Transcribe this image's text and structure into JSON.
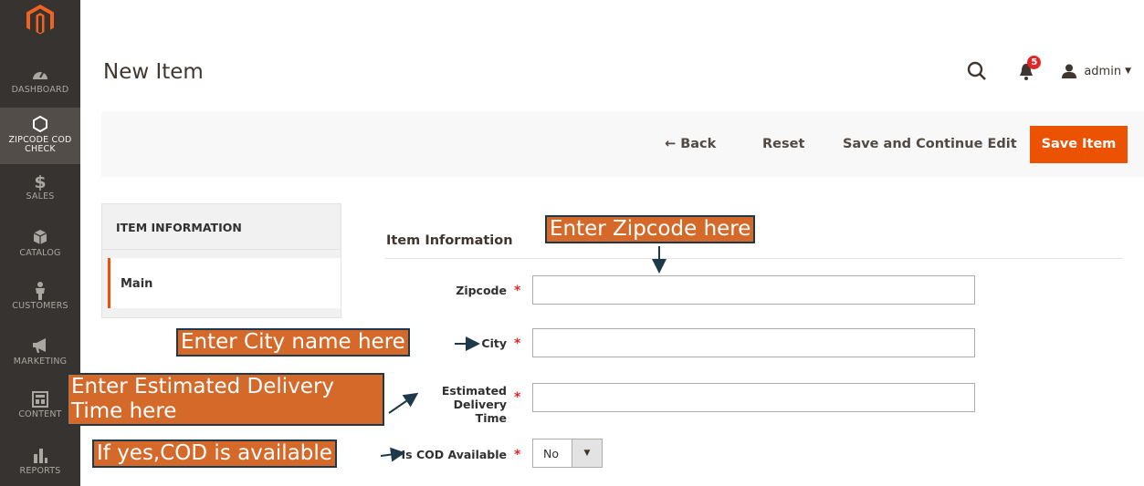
{
  "sidebar": {
    "items": [
      {
        "label": "DASHBOARD",
        "icon": "dashboard-icon"
      },
      {
        "label": "ZIPCODE COD CHECK",
        "label_line1": "ZIPCODE COD",
        "label_line2": "CHECK",
        "icon": "hexagon-icon"
      },
      {
        "label": "SALES",
        "icon": "dollar-icon"
      },
      {
        "label": "CATALOG",
        "icon": "cube-icon"
      },
      {
        "label": "CUSTOMERS",
        "icon": "person-icon"
      },
      {
        "label": "MARKETING",
        "icon": "megaphone-icon"
      },
      {
        "label": "CONTENT",
        "icon": "content-icon"
      },
      {
        "label": "REPORTS",
        "icon": "bar-chart-icon"
      }
    ]
  },
  "header": {
    "title": "New Item",
    "notifications_count": "5",
    "user": "admin"
  },
  "toolbar": {
    "back": "← Back",
    "reset": "Reset",
    "save_continue": "Save and Continue Edit",
    "save": "Save Item"
  },
  "tabs": {
    "title": "ITEM INFORMATION",
    "items": [
      "Main"
    ]
  },
  "form": {
    "fieldset_title": "Item Information",
    "zipcode_label": "Zipcode",
    "city_label": "City",
    "edt_label_line1": "Estimated Delivery",
    "edt_label_line2": "Time",
    "cod_label": "Is COD Available",
    "cod_value": "No",
    "required_mark": "*"
  },
  "annotations": {
    "zipcode": "Enter Zipcode here",
    "city": "Enter City name here",
    "edt_line1": "Enter Estimated Delivery",
    "edt_line2": "Time here",
    "cod": "If yes,COD is available"
  },
  "colors": {
    "accent": "#eb5202",
    "sidebar": "#373330",
    "callout": "#d4692a"
  }
}
